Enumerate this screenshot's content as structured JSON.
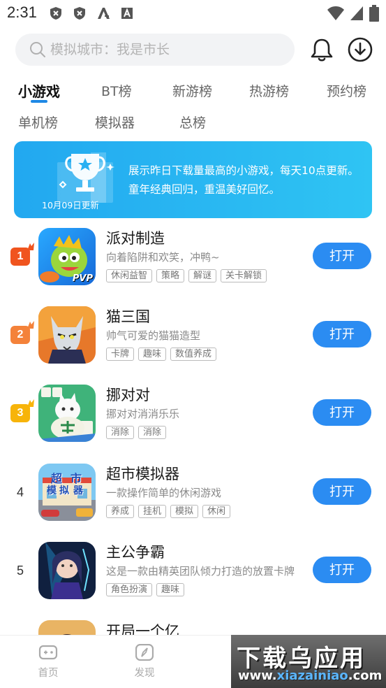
{
  "status_bar": {
    "time": "2:31"
  },
  "search": {
    "placeholder": "模拟城市：我是市长"
  },
  "tabs": [
    {
      "label": "小游戏"
    },
    {
      "label": "BT榜"
    },
    {
      "label": "新游榜"
    },
    {
      "label": "热游榜"
    },
    {
      "label": "预约榜"
    },
    {
      "label": "单机榜"
    },
    {
      "label": "模拟器"
    },
    {
      "label": "总榜"
    }
  ],
  "banner": {
    "date": "10月09日更新",
    "description": "展示昨日下载量最高的小游戏，每天10点更新。童年经典回归，重温美好回忆。"
  },
  "games": [
    {
      "rank": "1",
      "name": "派对制造",
      "desc": "向着陷阱和欢笑，冲鸭~",
      "tags": [
        "休闲益智",
        "策略",
        "解谜",
        "关卡解锁"
      ],
      "button": "打开",
      "icon_badge": "PVP"
    },
    {
      "rank": "2",
      "name": "猫三国",
      "desc": "帅气可爱的猫猫造型",
      "tags": [
        "卡牌",
        "趣味",
        "数值养成"
      ],
      "button": "打开"
    },
    {
      "rank": "3",
      "name": "挪对对",
      "desc": "挪对对消消乐乐",
      "tags": [
        "消除",
        "消除"
      ],
      "button": "打开"
    },
    {
      "rank": "4",
      "name": "超市模拟器",
      "desc": "一款操作简单的休闲游戏",
      "tags": [
        "养成",
        "挂机",
        "模拟",
        "休闲"
      ],
      "button": "打开",
      "icon_text": [
        "超",
        "市",
        "模",
        "拟",
        "器"
      ]
    },
    {
      "rank": "5",
      "name": "主公争霸",
      "desc": "这是一款由精英团队倾力打造的放置卡牌",
      "tags": [
        "角色扮演",
        "趣味"
      ],
      "button": "打开"
    },
    {
      "rank": "",
      "name": "开局一个亿"
    }
  ],
  "bottom_nav": [
    {
      "label": "首页"
    },
    {
      "label": "发现"
    }
  ],
  "watermark": {
    "title": "下载乌应用",
    "url_prefix": "www.",
    "url_main": "xiazainiao",
    "url_suffix": ".com"
  },
  "colors": {
    "accent": "#2b8cf2",
    "rank1": "#f0541e",
    "rank2": "#f4823a",
    "rank3": "#f7b40a",
    "banner": "#22a8f0"
  }
}
